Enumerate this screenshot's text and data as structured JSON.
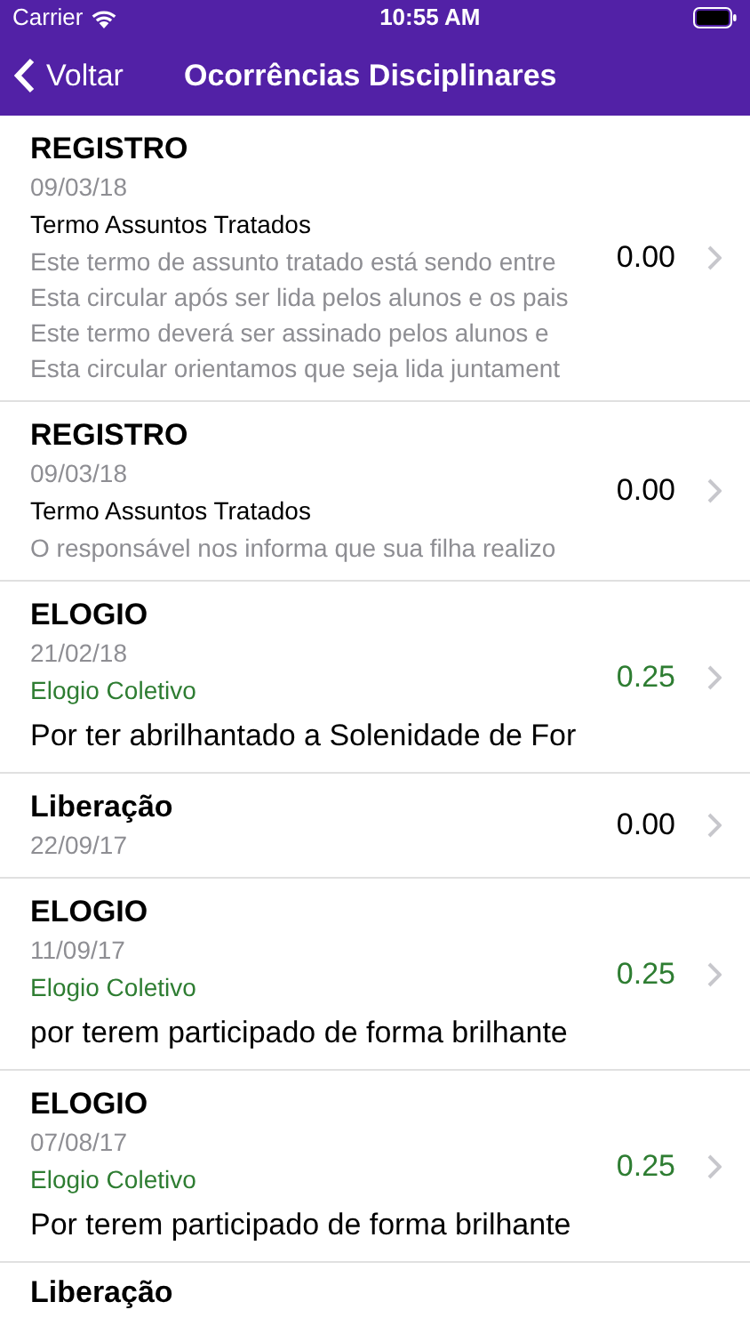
{
  "status_bar": {
    "carrier": "Carrier",
    "time": "10:55 AM"
  },
  "nav_bar": {
    "back": "Voltar",
    "title": "Ocorrências Disciplinares"
  },
  "items": [
    {
      "kind": "registro",
      "title": "REGISTRO",
      "date": "09/03/18",
      "subtitle": "Termo Assuntos Tratados",
      "lines": [
        "Este termo de assunto tratado está sendo entre",
        "Esta circular após ser lida pelos alunos e os pais",
        "Este termo deverá ser assinado pelos alunos e",
        "Esta circular orientamos que seja lida juntament"
      ],
      "value": "0.00"
    },
    {
      "kind": "registro",
      "title": "REGISTRO",
      "date": "09/03/18",
      "subtitle": "Termo Assuntos Tratados",
      "lines": [
        "O responsável nos informa que sua filha realizo"
      ],
      "value": "0.00"
    },
    {
      "kind": "elogio",
      "title": "ELOGIO",
      "date": "21/02/18",
      "subtitle": "Elogio Coletivo",
      "lines": [
        "Por ter abrilhantado a Solenidade de For"
      ],
      "value": "0.25"
    },
    {
      "kind": "liberacao",
      "title": "Liberação",
      "date": "22/09/17",
      "value": "0.00"
    },
    {
      "kind": "elogio",
      "title": "ELOGIO",
      "date": "11/09/17",
      "subtitle": "Elogio Coletivo",
      "lines": [
        "por terem participado de forma brilhante"
      ],
      "value": "0.25"
    },
    {
      "kind": "elogio",
      "title": "ELOGIO",
      "date": "07/08/17",
      "subtitle": "Elogio Coletivo",
      "lines": [
        "Por terem participado de forma brilhante"
      ],
      "value": "0.25"
    },
    {
      "kind": "liberacao",
      "title": "Liberação"
    }
  ]
}
